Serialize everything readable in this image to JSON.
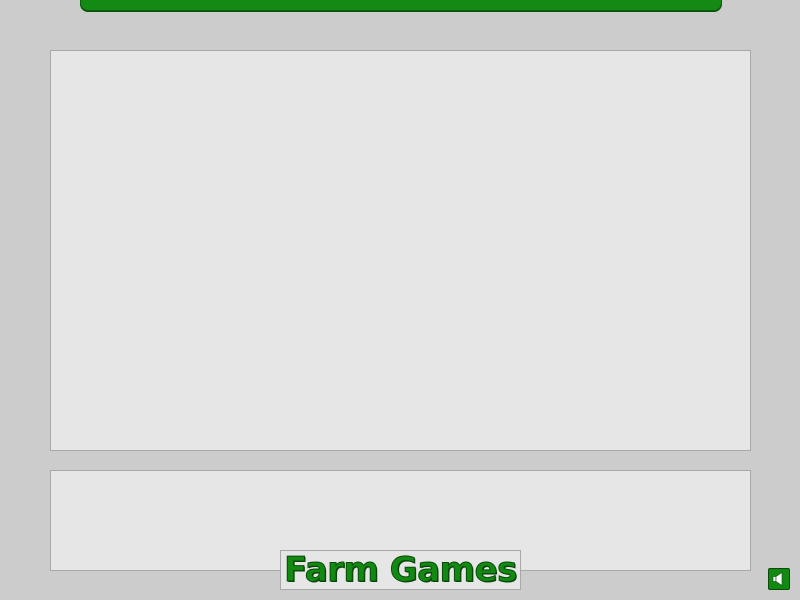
{
  "game": {
    "title": "Farm Games"
  },
  "controls": {
    "sound_icon": "speaker-icon"
  },
  "colors": {
    "accent_green": "#128a12",
    "panel_bg": "#e6e6e6",
    "page_bg": "#cccccc"
  }
}
